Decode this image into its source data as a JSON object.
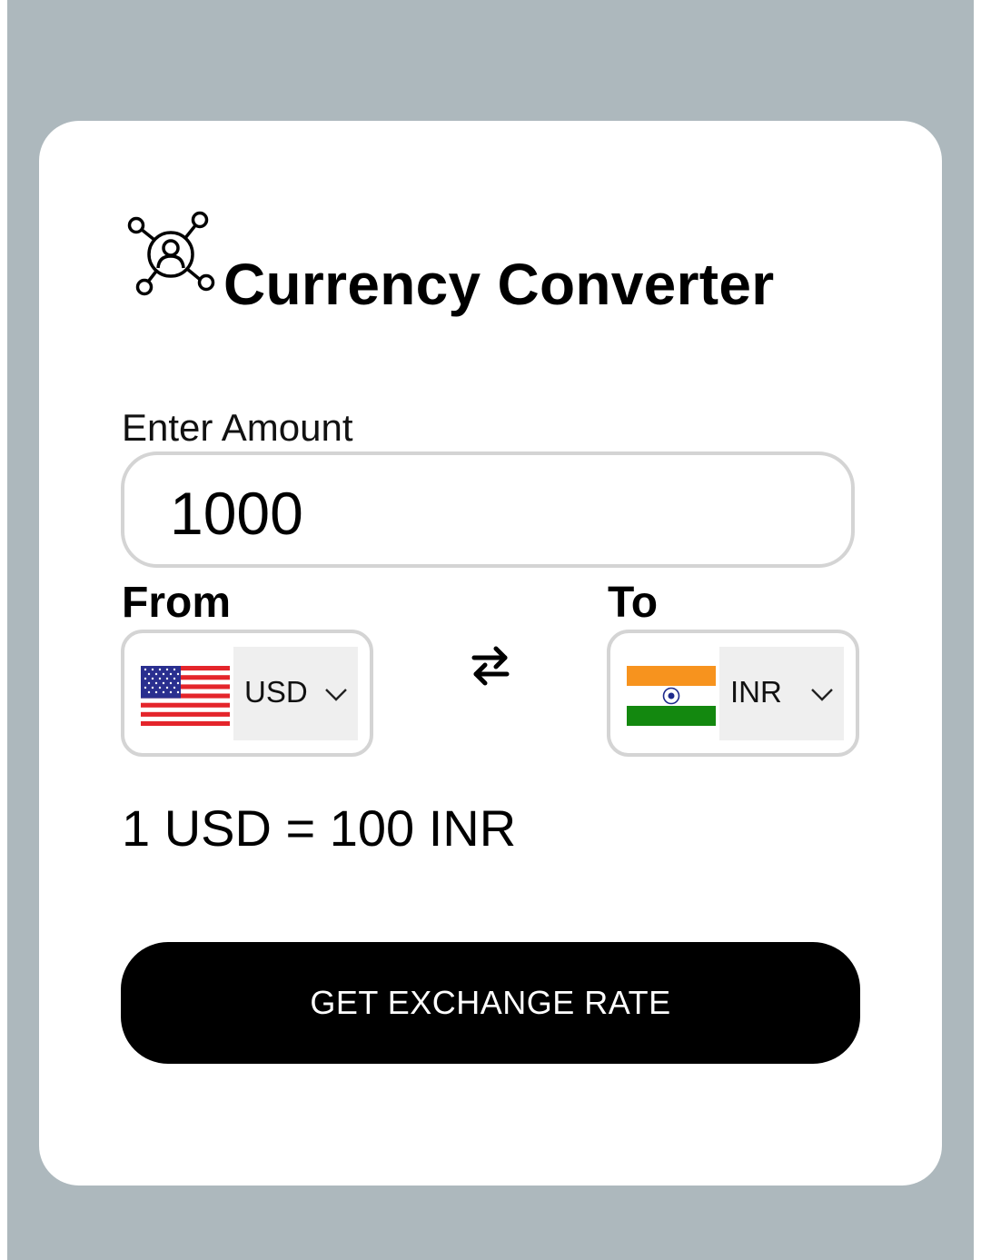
{
  "app": {
    "title": "Currency Converter",
    "logo_icon": "network-user-icon"
  },
  "amount": {
    "label": "Enter Amount",
    "value": "1000"
  },
  "from": {
    "label": "From",
    "currency": "USD",
    "flag_icon": "us-flag-icon"
  },
  "to": {
    "label": "To",
    "currency": "INR",
    "flag_icon": "india-flag-icon"
  },
  "swap_icon": "swap-arrows-icon",
  "rate_text": "1 USD = 100 INR",
  "action": {
    "label": "GET EXCHANGE RATE"
  },
  "colors": {
    "page_bg": "#adb8bd",
    "card_bg": "#ffffff",
    "button_bg": "#000000",
    "button_text": "#ffffff",
    "border": "#d4d4d4",
    "select_bg": "#efefef"
  }
}
